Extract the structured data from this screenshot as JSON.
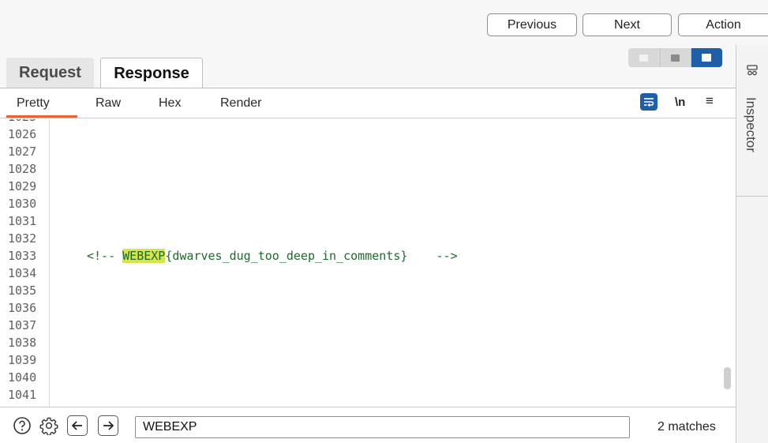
{
  "toolbar": {
    "previous_label": "Previous",
    "next_label": "Next",
    "action_label": "Action"
  },
  "tabs": {
    "request_label": "Request",
    "response_label": "Response",
    "active": "Response"
  },
  "view_toggle": {
    "options": [
      "split-horizontal-icon",
      "split-vertical-icon",
      "single-pane-icon"
    ],
    "active_index": 2
  },
  "subtabs": {
    "items": [
      "Pretty",
      "Raw",
      "Hex",
      "Render"
    ],
    "active": "Pretty",
    "newline_label": "\\n",
    "menu_icon": "hamburger-icon",
    "wrap_icon": "word-wrap-icon"
  },
  "editor": {
    "line_numbers": [
      "1026",
      "1027",
      "1028",
      "1029",
      "1030",
      "1031",
      "1032",
      "1033",
      "1034",
      "1035",
      "1036",
      "1037",
      "1038",
      "1039",
      "1040",
      "1041"
    ],
    "code_line_number": "1033",
    "code_prefix": "<!-- ",
    "code_match": "WEBEXP",
    "code_suffix": "{dwarves_dug_too_deep_in_comments}    -->"
  },
  "inspector": {
    "label": "Inspector",
    "icon": "inspector-icon"
  },
  "search": {
    "value": "WEBEXP",
    "matches_text": "2 matches"
  },
  "colors": {
    "accent": "#1f5ea8",
    "tab_underline": "#e8633a",
    "highlight": "#d8e44a",
    "code_text": "#1b6b2b"
  }
}
